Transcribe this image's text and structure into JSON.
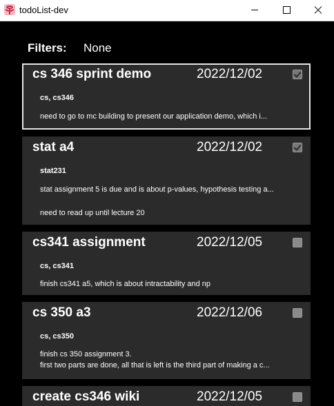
{
  "window": {
    "title": "todoList-dev"
  },
  "filters": {
    "label": "Filters:",
    "value": "None"
  },
  "tasks": [
    {
      "title": "cs 346 sprint demo",
      "date": "2022/12/02",
      "done": true,
      "selected": true,
      "tags": "cs, cs346",
      "description": [
        "need to go to mc building to present our application demo, which i..."
      ]
    },
    {
      "title": "stat a4",
      "date": "2022/12/02",
      "done": true,
      "selected": false,
      "tags": "stat231",
      "description": [
        "stat assignment 5 is due and is about p-values, hypothesis testing a...",
        "need to read up until lecture 20"
      ]
    },
    {
      "title": "cs341 assignment",
      "date": "2022/12/05",
      "done": false,
      "selected": false,
      "tags": "cs, cs341",
      "description": [
        "finish cs341 a5, which is about intractability and np"
      ]
    },
    {
      "title": "cs 350 a3",
      "date": "2022/12/06",
      "done": false,
      "selected": false,
      "tags": "cs, cs350",
      "description": [
        "finish cs 350 assignment 3.",
        "first two parts are done, all that is left is the third part of making a c..."
      ]
    },
    {
      "title": "create cs346 wiki",
      "date": "2022/12/05",
      "done": false,
      "selected": false
    }
  ],
  "colors": {
    "background": "#000000",
    "card": "#2b2b2b",
    "selected_border": "#e6e6e6",
    "text": "#ffffff",
    "checkbox": "#8a8a8a"
  }
}
